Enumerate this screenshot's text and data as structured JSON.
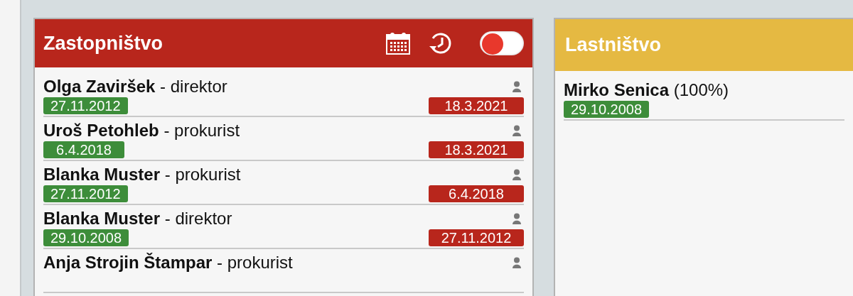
{
  "representation": {
    "title": "Zastopništvo",
    "toggle": {
      "on": false
    },
    "people": [
      {
        "name": "Olga Zaviršek",
        "role": "- direktor",
        "from": "27.11.2012",
        "to": "18.3.2021"
      },
      {
        "name": "Uroš Petohleb",
        "role": "- prokurist",
        "from": "6.4.2018",
        "to": "18.3.2021"
      },
      {
        "name": "Blanka Muster",
        "role": "- prokurist",
        "from": "27.11.2012",
        "to": "6.4.2018"
      },
      {
        "name": "Blanka Muster",
        "role": "- direktor",
        "from": "29.10.2008",
        "to": "27.11.2012"
      },
      {
        "name": "Anja Strojin Štampar",
        "role": "- prokurist"
      }
    ]
  },
  "ownership": {
    "title": "Lastništvo",
    "owners": [
      {
        "name": "Mirko Senica",
        "share": "(100%)",
        "from": "29.10.2008"
      }
    ]
  }
}
